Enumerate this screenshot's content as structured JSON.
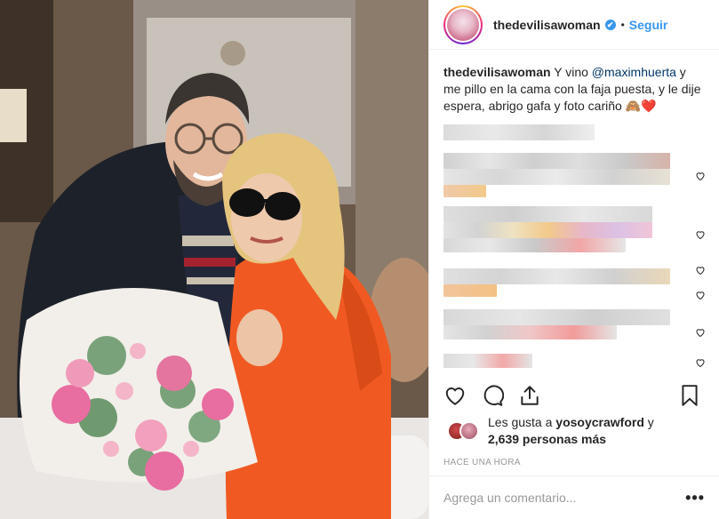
{
  "post": {
    "username": "thedevilisawoman",
    "verified_mark": "✔",
    "dot": "•",
    "follow_label": "Seguir",
    "caption_user": "thedevilisawoman",
    "caption_part1": " Y vino ",
    "caption_mention": "@maximhuerta",
    "caption_part2": " y me pillo en la cama con la faja puesta, y le dije espera, abrigo gafa y foto cariño 🙈❤️",
    "image_description_icon": "photo"
  },
  "actions": {
    "like_icon": "heart-icon",
    "comment_icon": "comment-icon",
    "share_icon": "share-icon",
    "save_icon": "bookmark-icon"
  },
  "likes": {
    "prefix": "Les gusta a ",
    "first_user": "yosoycrawford",
    "connector": " y",
    "count_text": "2,639 personas más"
  },
  "timestamp": "HACE UNA HORA",
  "comment_box": {
    "placeholder": "Agrega un comentario...",
    "more_label": "•••"
  },
  "colors": {
    "accent": "#3897f0",
    "text": "#262626",
    "muted": "#999999",
    "border": "#efefef",
    "coat": "#f15a22"
  }
}
